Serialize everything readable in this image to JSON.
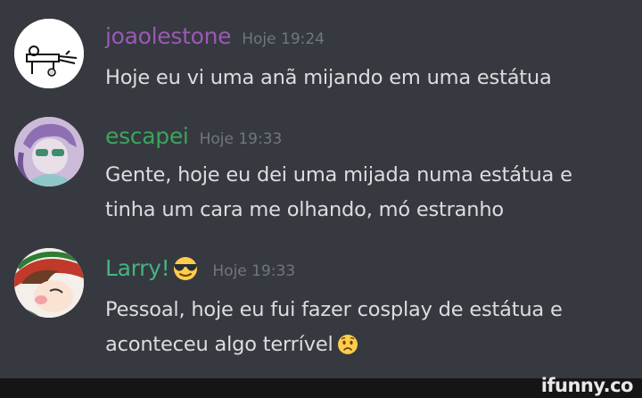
{
  "messages": [
    {
      "username": "joaolestone",
      "username_color": "#9b59b6",
      "timestamp": "Hoje 19:24",
      "text": "Hoje eu vi uma anã mijando em uma estátua"
    },
    {
      "username": "escapei",
      "username_color": "#3ba55c",
      "timestamp": "Hoje 19:33",
      "text": "Gente, hoje eu dei uma mijada numa estátua e tinha um cara me olhando, mó estranho"
    },
    {
      "username": "Larry!",
      "username_color": "#43b581",
      "username_emoji": "sunglasses-emoji",
      "timestamp": "Hoje 19:33",
      "text": "Pessoal, hoje eu fui fazer cosplay de estátua e aconteceu algo terrível",
      "trailing_emoji": "worried-face-emoji"
    }
  ],
  "watermark": {
    "text": "ifunny.co"
  }
}
